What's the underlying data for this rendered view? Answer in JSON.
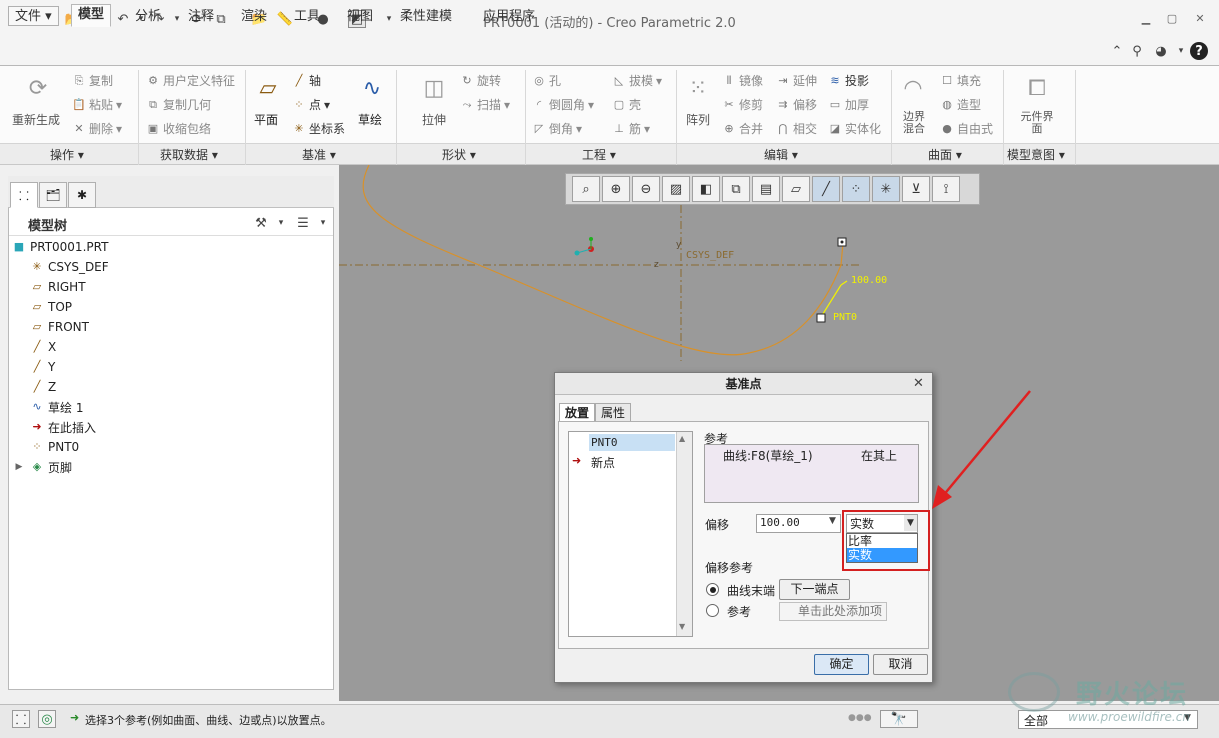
{
  "window": {
    "title": "PRT0001 (活动的) - Creo Parametric 2.0"
  },
  "tabs": [
    "文件",
    "模型",
    "分析",
    "注释",
    "渲染",
    "工具",
    "视图",
    "柔性建模",
    "应用程序"
  ],
  "ribbon": {
    "operations": {
      "regenerate": "重新生成",
      "copy": "复制",
      "paste": "粘贴",
      "delete": "删除",
      "group": "操作"
    },
    "get_data": {
      "udf": "用户定义特征",
      "copy_geom": "复制几何",
      "shrinkwrap": "收缩包络",
      "group": "获取数据"
    },
    "datum": {
      "plane": "平面",
      "axis": "轴",
      "point": "点",
      "csys": "坐标系",
      "sketch": "草绘",
      "group": "基准"
    },
    "shapes": {
      "extrude": "拉伸",
      "revolve": "旋转",
      "sweep": "扫描",
      "group": "形状"
    },
    "engineering": {
      "hole": "孔",
      "round": "倒圆角",
      "chamfer": "倒角",
      "draft": "拔模",
      "shell": "壳",
      "rib": "筋",
      "group": "工程"
    },
    "editing": {
      "pattern": "阵列",
      "mirror": "镜像",
      "trim": "修剪",
      "merge": "合并",
      "extend": "延伸",
      "offset": "偏移",
      "intersect": "相交",
      "project": "投影",
      "thicken": "加厚",
      "solidify": "实体化",
      "group": "编辑"
    },
    "surfaces": {
      "boundary_blend": "边界混合",
      "fill": "填充",
      "style": "造型",
      "freestyle": "自由式",
      "group": "曲面"
    },
    "intent": {
      "component_interface": "元件界面",
      "group": "模型意图"
    }
  },
  "model_tree": {
    "title": "模型树",
    "items": [
      "PRT0001.PRT",
      "CSYS_DEF",
      "RIGHT",
      "TOP",
      "FRONT",
      "X",
      "Y",
      "Z",
      "草绘 1",
      "在此插入",
      "PNT0",
      "页脚"
    ]
  },
  "graphics": {
    "csys_label": "CSYS_DEF",
    "offset_value_label": "100.00",
    "point_label": "PNT0",
    "axis_y": "y",
    "axis_z": "z"
  },
  "dialog": {
    "title": "基准点",
    "tabs": [
      "放置",
      "属性"
    ],
    "point_list": [
      "PNT0",
      "新点"
    ],
    "references_label": "参考",
    "reference_item": "曲线:F8(草绘_1)",
    "reference_constraint": "在其上",
    "offset_label": "偏移",
    "offset_value": "100.00",
    "offset_type_selected": "实数",
    "offset_type_options": [
      "比率",
      "实数"
    ],
    "offset_ref_label": "偏移参考",
    "radio_curve_end": "曲线末端",
    "next_end_button": "下一端点",
    "radio_reference": "参考",
    "add_item_placeholder": "单击此处添加项",
    "ok": "确定",
    "cancel": "取消"
  },
  "status": {
    "message": "选择3个参考(例如曲面、曲线、边或点)以放置点。",
    "filter": "全部"
  },
  "watermark": {
    "text": "野火论坛",
    "url": "www.proewildfire.cn"
  },
  "colors": {
    "curve": "#d8912a",
    "highlight_box": "#d42020",
    "arrow": "#e02020",
    "dim": "#f2f200"
  }
}
